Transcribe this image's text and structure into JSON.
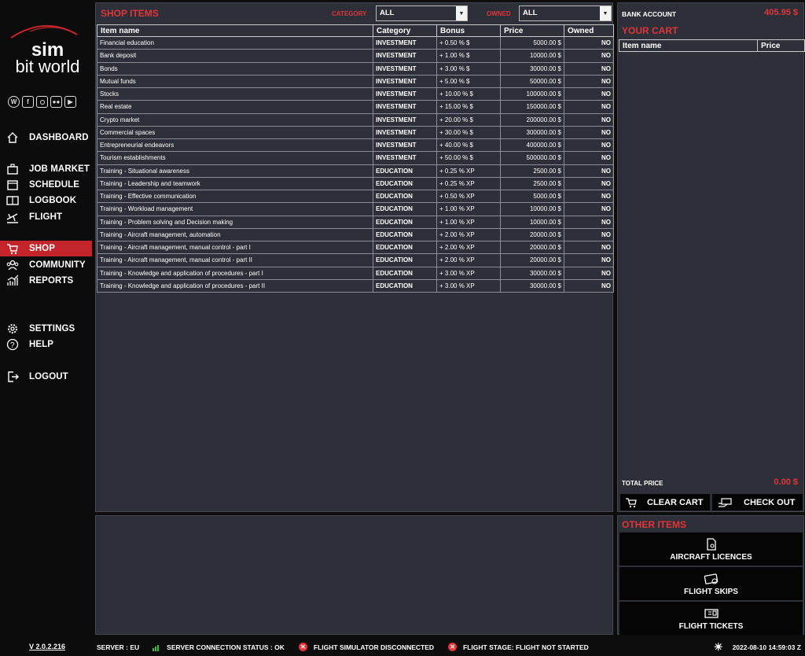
{
  "brand": {
    "line1": "sim",
    "line2": "bit world"
  },
  "social_icons": [
    "www-icon",
    "facebook-icon",
    "instagram-icon",
    "discord-icon",
    "youtube-icon"
  ],
  "nav": [
    {
      "key": "dashboard",
      "label": "DASHBOARD",
      "icon": "home-icon",
      "active": false
    },
    {
      "key": "job-market",
      "label": "JOB MARKET",
      "icon": "briefcase-icon",
      "active": false
    },
    {
      "key": "schedule",
      "label": "SCHEDULE",
      "icon": "calendar-icon",
      "active": false
    },
    {
      "key": "logbook",
      "label": "LOGBOOK",
      "icon": "logbook-icon",
      "active": false
    },
    {
      "key": "flight",
      "label": "FLIGHT",
      "icon": "plane-icon",
      "active": false
    },
    {
      "key": "shop",
      "label": "SHOP",
      "icon": "cart-icon",
      "active": true
    },
    {
      "key": "community",
      "label": "COMMUNITY",
      "icon": "people-icon",
      "active": false
    },
    {
      "key": "reports",
      "label": "REPORTS",
      "icon": "chart-icon",
      "active": false
    },
    {
      "key": "settings",
      "label": "SETTINGS",
      "icon": "gear-icon",
      "active": false
    },
    {
      "key": "help",
      "label": "HELP",
      "icon": "help-icon",
      "active": false
    },
    {
      "key": "logout",
      "label": "LOGOUT",
      "icon": "logout-icon",
      "active": false
    }
  ],
  "version": "V 2.0.2.216",
  "shop": {
    "title": "SHOP ITEMS",
    "category_label": "CATEGORY",
    "category_value": "ALL",
    "owned_label": "OWNED",
    "owned_value": "ALL",
    "columns": [
      "Item name",
      "Category",
      "Bonus",
      "Price",
      "Owned"
    ],
    "rows": [
      [
        "Financial education",
        "INVESTMENT",
        "+ 0.50 % $",
        "5000.00 $",
        "NO"
      ],
      [
        "Bank deposit",
        "INVESTMENT",
        "+ 1.00 % $",
        "10000.00 $",
        "NO"
      ],
      [
        "Bonds",
        "INVESTMENT",
        "+ 3.00 % $",
        "30000.00 $",
        "NO"
      ],
      [
        "Mutual funds",
        "INVESTMENT",
        "+ 5.00 % $",
        "50000.00 $",
        "NO"
      ],
      [
        "Stocks",
        "INVESTMENT",
        "+ 10.00 % $",
        "100000.00 $",
        "NO"
      ],
      [
        "Real estate",
        "INVESTMENT",
        "+ 15.00 % $",
        "150000.00 $",
        "NO"
      ],
      [
        "Crypto market",
        "INVESTMENT",
        "+ 20.00 % $",
        "200000.00 $",
        "NO"
      ],
      [
        "Commercial spaces",
        "INVESTMENT",
        "+ 30.00 % $",
        "300000.00 $",
        "NO"
      ],
      [
        "Entrepreneurial endeavors",
        "INVESTMENT",
        "+ 40.00 % $",
        "400000.00 $",
        "NO"
      ],
      [
        "Tourism establishments",
        "INVESTMENT",
        "+ 50.00 % $",
        "500000.00 $",
        "NO"
      ],
      [
        "Training - Situational awareness",
        "EDUCATION",
        "+ 0.25 % XP",
        "2500.00 $",
        "NO"
      ],
      [
        "Training - Leadership and teamwork",
        "EDUCATION",
        "+ 0.25 % XP",
        "2500.00 $",
        "NO"
      ],
      [
        "Training - Effective communication",
        "EDUCATION",
        "+ 0.50 % XP",
        "5000.00 $",
        "NO"
      ],
      [
        "Training - Workload management",
        "EDUCATION",
        "+ 1.00 % XP",
        "10000.00 $",
        "NO"
      ],
      [
        "Training - Problem solving and Decision making",
        "EDUCATION",
        "+ 1.00 % XP",
        "10000.00 $",
        "NO"
      ],
      [
        "Training - Aircraft management, automation",
        "EDUCATION",
        "+ 2.00 % XP",
        "20000.00 $",
        "NO"
      ],
      [
        "Training - Aircraft management, manual control - part I",
        "EDUCATION",
        "+ 2.00 % XP",
        "20000.00 $",
        "NO"
      ],
      [
        "Training - Aircraft management, manual control - part II",
        "EDUCATION",
        "+ 2.00 % XP",
        "20000.00 $",
        "NO"
      ],
      [
        "Training - Knowledge and application of procedures - part I",
        "EDUCATION",
        "+ 3.00 % XP",
        "30000.00 $",
        "NO"
      ],
      [
        "Training - Knowledge and application of procedures - part II",
        "EDUCATION",
        "+ 3.00 % XP",
        "30000.00 $",
        "NO"
      ]
    ]
  },
  "account": {
    "bank_label": "BANK ACCOUNT",
    "bank_value": "405.95 $",
    "cart_title": "YOUR CART",
    "cart_columns": [
      "Item name",
      "Price"
    ],
    "total_label": "TOTAL PRICE",
    "total_value": "0.00 $",
    "clear_label": "CLEAR CART",
    "checkout_label": "CHECK OUT"
  },
  "other": {
    "title": "OTHER ITEMS",
    "buttons": [
      {
        "label": "AIRCRAFT LICENCES",
        "icon": "licence-icon"
      },
      {
        "label": "FLIGHT SKIPS",
        "icon": "ticket-skip-icon"
      },
      {
        "label": "FLIGHT TICKETS",
        "icon": "ticket-icon"
      }
    ]
  },
  "status": {
    "server": "SERVER : EU",
    "connection": "SERVER CONNECTION STATUS : OK",
    "simulator": "FLIGHT SIMULATOR DISCONNECTED",
    "stage": "FLIGHT STAGE: FLIGHT NOT STARTED",
    "datetime": "2022-08-10 14:59:03 Z"
  },
  "colors": {
    "accent": "#e1353a",
    "active_nav": "#c3252b",
    "panel": "#2d3038",
    "background": "#0d0d0d",
    "signal": "#3bbf3b"
  }
}
